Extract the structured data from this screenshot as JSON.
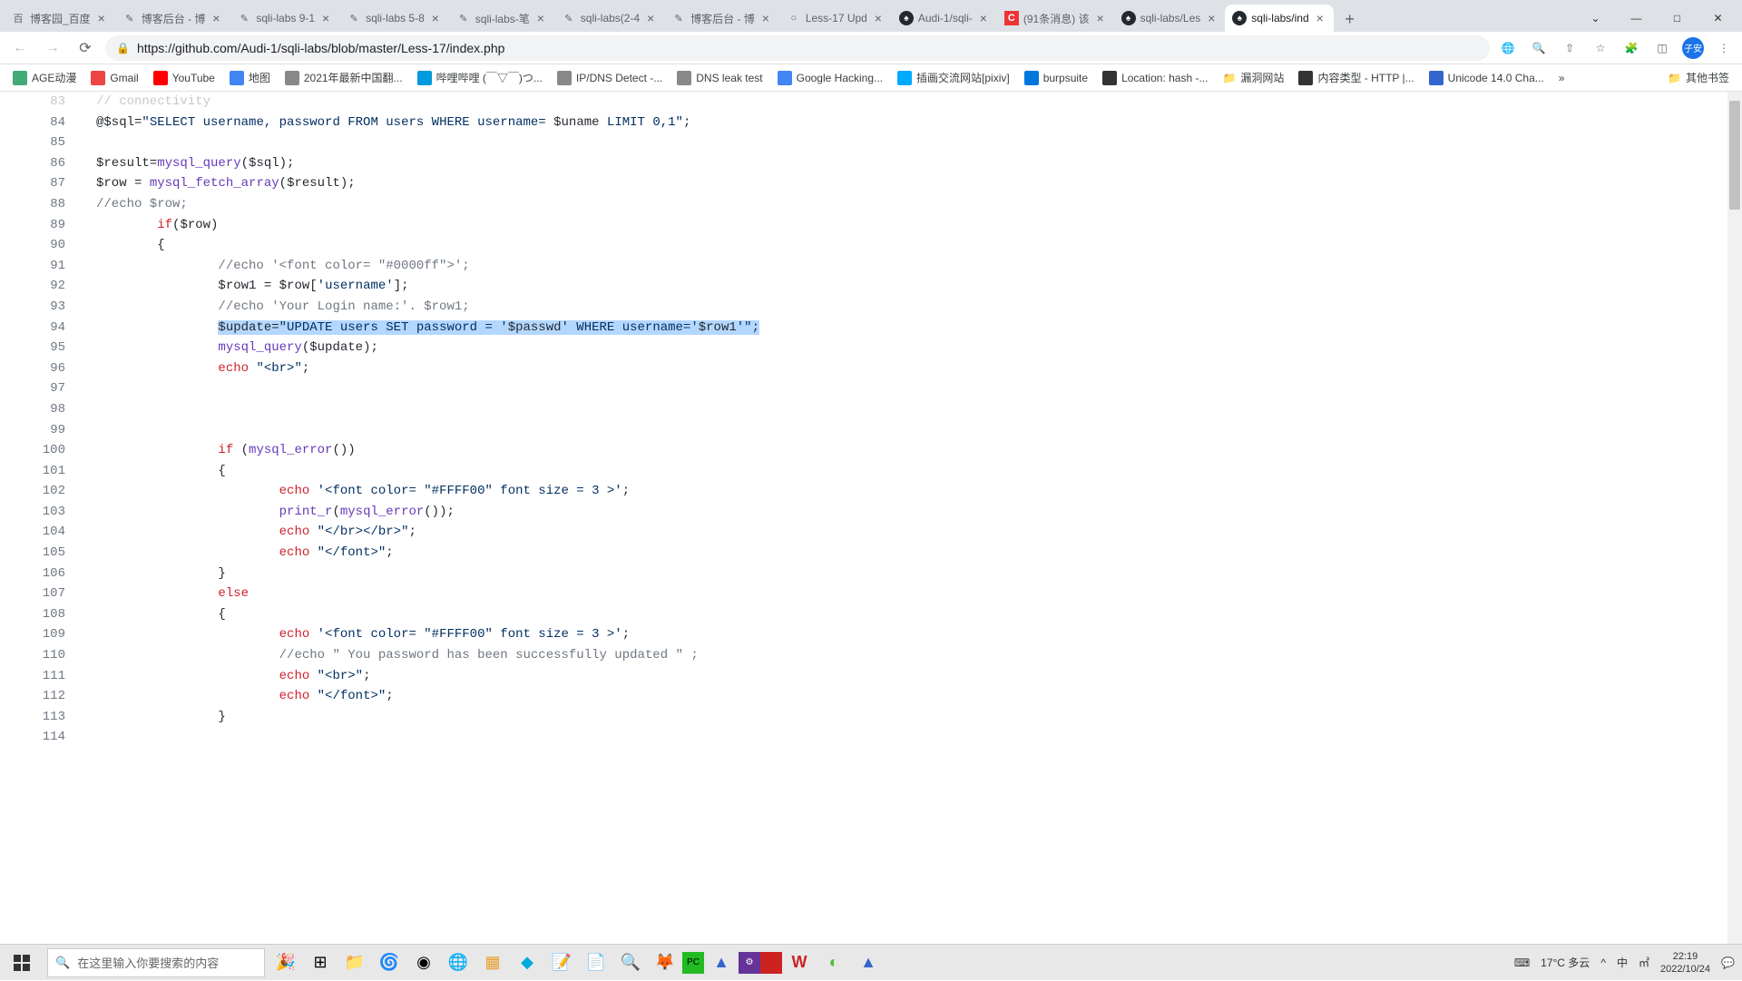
{
  "tabs": [
    {
      "title": "博客园_百度",
      "icon": "百"
    },
    {
      "title": "博客后台 - 博",
      "icon": "✎"
    },
    {
      "title": "sqli-labs 9-1",
      "icon": "✎"
    },
    {
      "title": "sqli-labs 5-8",
      "icon": "✎"
    },
    {
      "title": "sqli-labs-笔",
      "icon": "✎"
    },
    {
      "title": "sqli-labs(2-4",
      "icon": "✎"
    },
    {
      "title": "博客后台 - 博",
      "icon": "✎"
    },
    {
      "title": "Less-17 Upd",
      "icon": "○"
    },
    {
      "title": "Audi-1/sqli-",
      "icon": "gh"
    },
    {
      "title": "(91条消息) 该",
      "icon": "C"
    },
    {
      "title": "sqli-labs/Les",
      "icon": "gh"
    },
    {
      "title": "sqli-labs/ind",
      "icon": "gh",
      "active": true
    }
  ],
  "url": "https://github.com/Audi-1/sqli-labs/blob/master/Less-17/index.php",
  "bookmarks": [
    {
      "label": "AGE动漫",
      "color": "#4a7"
    },
    {
      "label": "Gmail",
      "color": "#e44"
    },
    {
      "label": "YouTube",
      "color": "#f00"
    },
    {
      "label": "地图",
      "color": "#4285f4"
    },
    {
      "label": "2021年最新中国翻...",
      "color": "#888"
    },
    {
      "label": "哔哩哔哩 (￣▽￣)つ...",
      "color": "#09d"
    },
    {
      "label": "IP/DNS Detect -...",
      "color": "#888"
    },
    {
      "label": "DNS leak test",
      "color": "#888"
    },
    {
      "label": "Google Hacking...",
      "color": "#4285f4"
    },
    {
      "label": "插画交流网站[pixiv]",
      "color": "#0af"
    },
    {
      "label": "burpsuite",
      "color": "#07d"
    },
    {
      "label": "Location: hash -...",
      "color": "#333"
    },
    {
      "label": "漏洞网站",
      "folder": true
    },
    {
      "label": "内容类型 - HTTP |...",
      "color": "#333"
    },
    {
      "label": "Unicode 14.0 Cha...",
      "color": "#36c"
    }
  ],
  "bookmarks_overflow": "»",
  "bookmarks_folder": "其他书签",
  "code": [
    {
      "n": 83,
      "t": "// connectivity",
      "cls": "cmt",
      "partial": true
    },
    {
      "n": 84,
      "segs": [
        [
          "@",
          ""
        ],
        [
          "$sql",
          "var"
        ],
        [
          "=",
          ""
        ],
        [
          "\"SELECT username, password FROM users WHERE username= ",
          "str"
        ],
        [
          "$uname",
          "var-in-str"
        ],
        [
          " LIMIT 0,1\"",
          "str"
        ],
        [
          ";",
          ""
        ]
      ]
    },
    {
      "n": 85,
      "t": ""
    },
    {
      "n": 86,
      "segs": [
        [
          "$result",
          "var"
        ],
        [
          "=",
          ""
        ],
        [
          "mysql_query",
          "fn"
        ],
        [
          "(",
          ""
        ],
        [
          "$sql",
          "var"
        ],
        [
          ");",
          ""
        ]
      ]
    },
    {
      "n": 87,
      "segs": [
        [
          "$row",
          "var"
        ],
        [
          " = ",
          ""
        ],
        [
          "mysql_fetch_array",
          "fn"
        ],
        [
          "(",
          ""
        ],
        [
          "$result",
          "var"
        ],
        [
          ");",
          ""
        ]
      ]
    },
    {
      "n": 88,
      "t": "//echo $row;",
      "cls": "cmt"
    },
    {
      "n": 89,
      "indent": "        ",
      "segs": [
        [
          "if",
          "kw"
        ],
        [
          "(",
          ""
        ],
        [
          "$row",
          "var"
        ],
        [
          ")",
          ""
        ]
      ]
    },
    {
      "n": 90,
      "indent": "        ",
      "t": "{"
    },
    {
      "n": 91,
      "indent": "                ",
      "t": "//echo '<font color= \"#0000ff\">';",
      "cls": "cmt"
    },
    {
      "n": 92,
      "indent": "                ",
      "segs": [
        [
          "$row1",
          "var"
        ],
        [
          " = ",
          ""
        ],
        [
          "$row",
          "var"
        ],
        [
          "[",
          ""
        ],
        [
          "'username'",
          "str"
        ],
        [
          "];",
          ""
        ]
      ]
    },
    {
      "n": 93,
      "indent": "                ",
      "t": "//echo 'Your Login name:'. $row1;",
      "cls": "cmt"
    },
    {
      "n": 94,
      "indent": "                ",
      "selected": true,
      "segs": [
        [
          "$update",
          "var"
        ],
        [
          "=",
          ""
        ],
        [
          "\"UPDATE users SET password = '",
          "str"
        ],
        [
          "$passwd",
          "var-in-str"
        ],
        [
          "' WHERE username='",
          "str"
        ],
        [
          "$row1",
          "var-in-str"
        ],
        [
          "'\"",
          "str"
        ],
        [
          ";",
          ""
        ]
      ]
    },
    {
      "n": 95,
      "indent": "                ",
      "segs": [
        [
          "mysql_query",
          "fn"
        ],
        [
          "(",
          ""
        ],
        [
          "$update",
          "var"
        ],
        [
          ");",
          ""
        ]
      ]
    },
    {
      "n": 96,
      "indent": "                ",
      "segs": [
        [
          "echo",
          "kw"
        ],
        [
          " ",
          ""
        ],
        [
          "\"<br>\"",
          "str"
        ],
        [
          ";",
          ""
        ]
      ]
    },
    {
      "n": 97,
      "t": ""
    },
    {
      "n": 98,
      "t": ""
    },
    {
      "n": 99,
      "t": ""
    },
    {
      "n": 100,
      "indent": "                ",
      "segs": [
        [
          "if",
          "kw"
        ],
        [
          " (",
          ""
        ],
        [
          "mysql_error",
          "fn"
        ],
        [
          "())",
          ""
        ]
      ]
    },
    {
      "n": 101,
      "indent": "                ",
      "t": "{"
    },
    {
      "n": 102,
      "indent": "                        ",
      "segs": [
        [
          "echo",
          "kw"
        ],
        [
          " ",
          ""
        ],
        [
          "'<font color= \"#FFFF00\" font size = 3 >'",
          "str"
        ],
        [
          ";",
          ""
        ]
      ]
    },
    {
      "n": 103,
      "indent": "                        ",
      "segs": [
        [
          "print_r",
          "fn"
        ],
        [
          "(",
          ""
        ],
        [
          "mysql_error",
          "fn"
        ],
        [
          "());",
          ""
        ]
      ]
    },
    {
      "n": 104,
      "indent": "                        ",
      "segs": [
        [
          "echo",
          "kw"
        ],
        [
          " ",
          ""
        ],
        [
          "\"</br></br>\"",
          "str"
        ],
        [
          ";",
          ""
        ]
      ]
    },
    {
      "n": 105,
      "indent": "                        ",
      "segs": [
        [
          "echo",
          "kw"
        ],
        [
          " ",
          ""
        ],
        [
          "\"</font>\"",
          "str"
        ],
        [
          ";",
          ""
        ]
      ]
    },
    {
      "n": 106,
      "indent": "                ",
      "t": "}"
    },
    {
      "n": 107,
      "indent": "                ",
      "segs": [
        [
          "else",
          "kw"
        ]
      ]
    },
    {
      "n": 108,
      "indent": "                ",
      "t": "{"
    },
    {
      "n": 109,
      "indent": "                        ",
      "segs": [
        [
          "echo",
          "kw"
        ],
        [
          " ",
          ""
        ],
        [
          "'<font color= \"#FFFF00\" font size = 3 >'",
          "str"
        ],
        [
          ";",
          ""
        ]
      ]
    },
    {
      "n": 110,
      "indent": "                        ",
      "t": "//echo \" You password has been successfully updated \" ;",
      "cls": "cmt"
    },
    {
      "n": 111,
      "indent": "                        ",
      "segs": [
        [
          "echo",
          "kw"
        ],
        [
          " ",
          ""
        ],
        [
          "\"<br>\"",
          "str"
        ],
        [
          ";",
          ""
        ]
      ]
    },
    {
      "n": 112,
      "indent": "                        ",
      "segs": [
        [
          "echo",
          "kw"
        ],
        [
          " ",
          ""
        ],
        [
          "\"</font>\"",
          "str"
        ],
        [
          ";",
          ""
        ]
      ]
    },
    {
      "n": 113,
      "indent": "                ",
      "t": "}"
    },
    {
      "n": 114,
      "t": ""
    }
  ],
  "search_placeholder": "在这里输入你要搜索的内容",
  "weather": "17°C 多云",
  "ime": "^ 中 ㎡",
  "time": "22:19",
  "date": "2022/10/24",
  "avatar": "子安"
}
